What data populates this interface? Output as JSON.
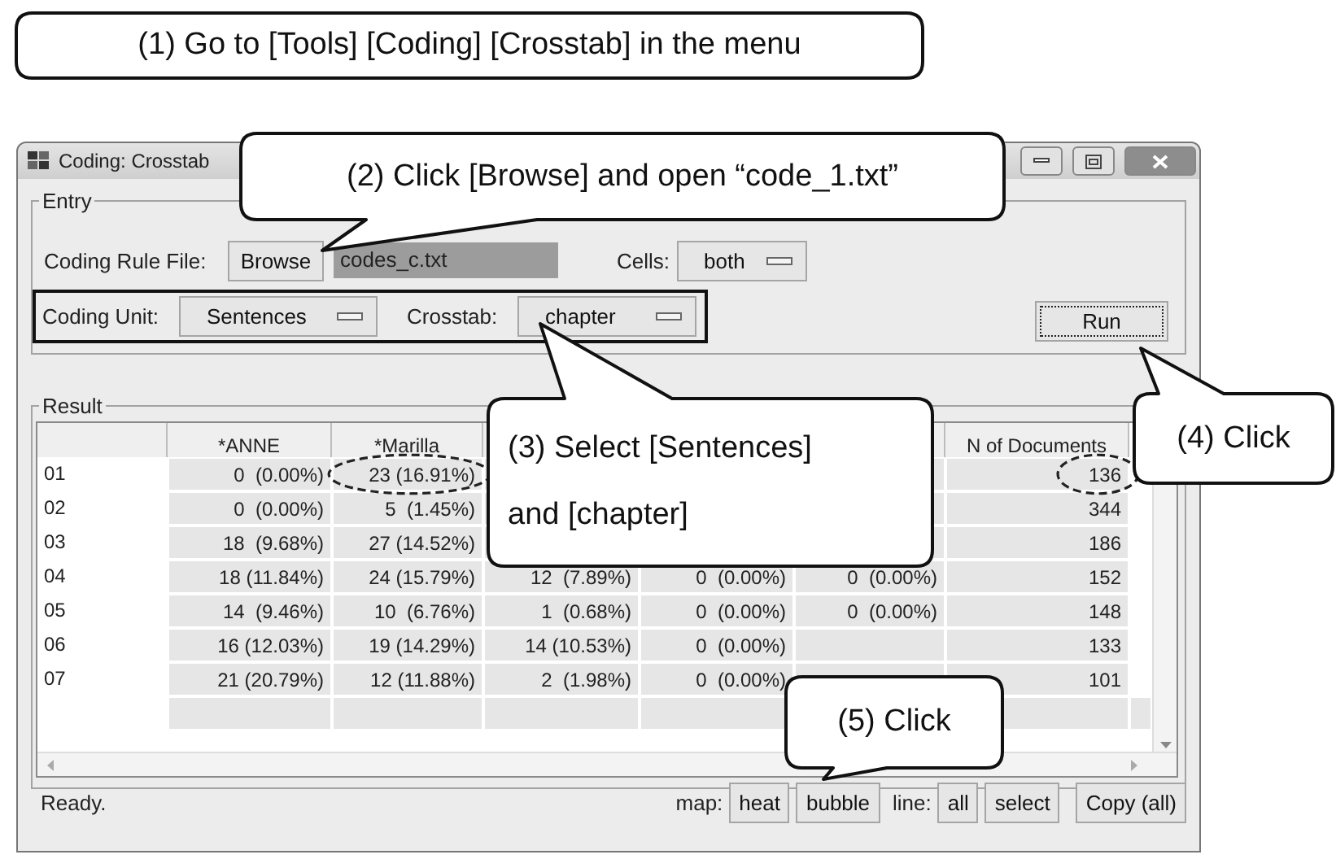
{
  "callouts": [
    {
      "lines": [
        "(1) Go to [Tools] [Coding] [Crosstab] in the menu"
      ]
    },
    {
      "lines": [
        "(2) Click [Browse] and open “code_1.txt”"
      ]
    },
    {
      "lines": [
        "(3) Select [Sentences]",
        "and [chapter]"
      ]
    },
    {
      "lines": [
        "(4) Click"
      ]
    },
    {
      "lines": [
        "(5) Click"
      ]
    }
  ],
  "window": {
    "title": "Coding: Crosstab"
  },
  "entry": {
    "label": "Entry",
    "rule_file_label": "Coding Rule File:",
    "browse_button": "Browse",
    "rule_file": "codes_c.txt",
    "cells_label": "Cells:",
    "cells_value": "both",
    "unit_label": "Coding Unit:",
    "unit_value": "Sentences",
    "crosstab_label": "Crosstab:",
    "crosstab_value": "chapter",
    "unit_row_outlined": true,
    "run_button": {
      "label": "Run",
      "focused": true
    }
  },
  "result": {
    "label": "Result",
    "columns": [
      "*ANNE",
      "*Marilla",
      null,
      null,
      null,
      "N of Documents"
    ],
    "rows": [
      {
        "label": "01",
        "cells": [
          {
            "text": "0  (0.00%)",
            "circled": false
          },
          {
            "text": "23 (16.91%)",
            "circled": true
          },
          null,
          null,
          null,
          {
            "text": "136",
            "circled": true
          }
        ]
      },
      {
        "label": "02",
        "cells": [
          {
            "text": "0  (0.00%)",
            "circled": false
          },
          {
            "text": "5  (1.45%)",
            "circled": false
          },
          null,
          null,
          null,
          {
            "text": "344",
            "circled": false
          }
        ]
      },
      {
        "label": "03",
        "cells": [
          {
            "text": "18  (9.68%)",
            "circled": false
          },
          {
            "text": "27 (14.52%)",
            "circled": false
          },
          null,
          null,
          null,
          {
            "text": "186",
            "circled": false
          }
        ]
      },
      {
        "label": "04",
        "cells": [
          {
            "text": "18 (11.84%)",
            "circled": false
          },
          {
            "text": "24 (15.79%)",
            "circled": false
          },
          {
            "text": "12  (7.89%)",
            "circled": false
          },
          {
            "text": "0  (0.00%)",
            "circled": false
          },
          {
            "text": "0  (0.00%)",
            "circled": false
          },
          {
            "text": "152",
            "circled": false
          }
        ]
      },
      {
        "label": "05",
        "cells": [
          {
            "text": "14  (9.46%)",
            "circled": false
          },
          {
            "text": "10  (6.76%)",
            "circled": false
          },
          {
            "text": "1  (0.68%)",
            "circled": false
          },
          {
            "text": "0  (0.00%)",
            "circled": false
          },
          {
            "text": "0  (0.00%)",
            "circled": false
          },
          {
            "text": "148",
            "circled": false
          }
        ]
      },
      {
        "label": "06",
        "cells": [
          {
            "text": "16 (12.03%)",
            "circled": false
          },
          {
            "text": "19 (14.29%)",
            "circled": false
          },
          {
            "text": "14 (10.53%)",
            "circled": false
          },
          {
            "text": "0  (0.00%)",
            "circled": false
          },
          null,
          {
            "text": "133",
            "circled": false
          }
        ]
      },
      {
        "label": "07",
        "cells": [
          {
            "text": "21 (20.79%)",
            "circled": false
          },
          {
            "text": "12 (11.88%)",
            "circled": false
          },
          {
            "text": "2  (1.98%)",
            "circled": false
          },
          {
            "text": "0  (0.00%)",
            "circled": false
          },
          null,
          {
            "text": "101",
            "circled": false
          }
        ]
      }
    ]
  },
  "status": {
    "text": "Ready.",
    "map_label": "map:",
    "map_buttons": [
      "heat",
      "bubble"
    ],
    "line_label": "line:",
    "line_buttons": [
      "all",
      "select"
    ],
    "copy_button": "Copy (all)"
  }
}
